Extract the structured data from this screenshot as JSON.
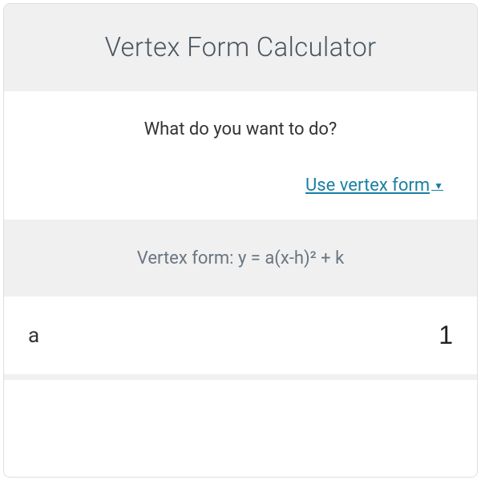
{
  "header": {
    "title": "Vertex Form Calculator"
  },
  "question": {
    "prompt": "What do you want to do?",
    "selected_option": "Use vertex form"
  },
  "formula": {
    "label": "Vertex form: y = a(x-h)² + k"
  },
  "inputs": {
    "a": {
      "label": "a",
      "value": "1"
    }
  },
  "colors": {
    "accent": "#1a7fa3",
    "header_bg": "#f0f0f0",
    "text_muted": "#6a7580",
    "text_heading": "#4a5560"
  }
}
